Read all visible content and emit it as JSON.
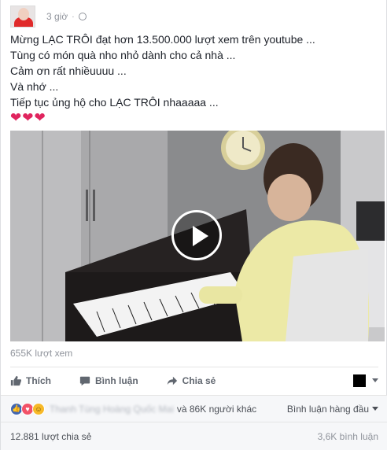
{
  "post": {
    "time": "3 giờ",
    "privacy_icon": "globe-icon",
    "lines": [
      "Mừng LẠC TRÔI đạt hơn 13.500.000 lượt xem trên youtube ...",
      "Tùng có món quà nho nhỏ dành cho cả nhà ...",
      "Cảm ơn rất nhiềuuuu ...",
      "Và nhớ ...",
      "Tiếp tục ủng hộ cho LẠC TRÔI nhaaaaa ..."
    ],
    "hearts": "❤❤❤"
  },
  "video": {
    "views": "655K lượt xem"
  },
  "actions": {
    "like": "Thích",
    "comment": "Bình luận",
    "share": "Chia sẻ"
  },
  "reactions": {
    "names": "Thanh Tùng Hoàng Quốc Mai",
    "others": "và 86K người khác",
    "top_comments": "Bình luận hàng đầu"
  },
  "footer": {
    "shares": "12.881 lượt chia sẻ",
    "comments": "3,6K bình luận"
  },
  "colors": {
    "accent": "#4267b2",
    "love": "#f25268",
    "heart": "#e0245e"
  }
}
